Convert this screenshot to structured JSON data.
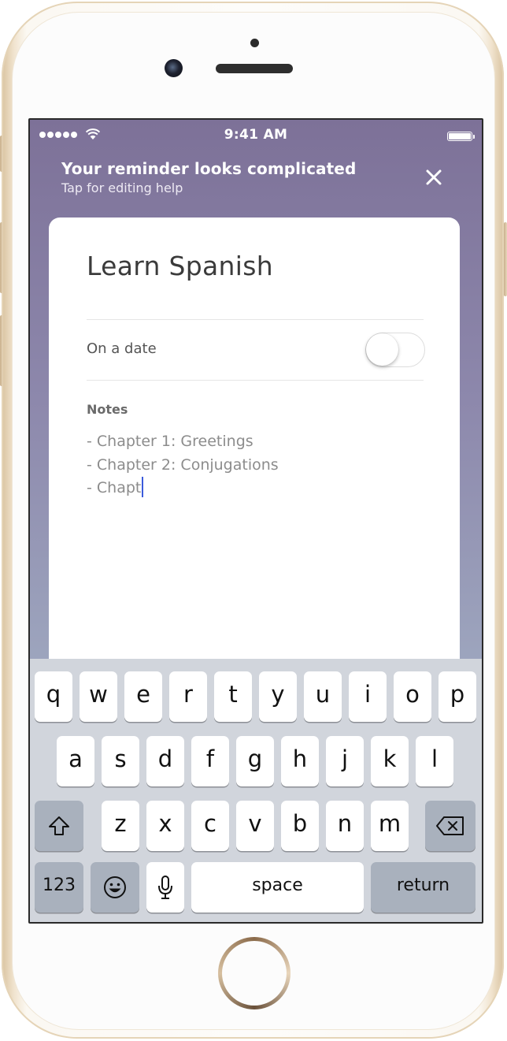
{
  "status_bar": {
    "time": "9:41 AM"
  },
  "banner": {
    "title": "Your reminder looks complicated",
    "subtitle": "Tap for editing help",
    "close_icon": "close-icon"
  },
  "reminder": {
    "title": "Learn Spanish",
    "date_toggle_label": "On a date",
    "date_toggle_on": false,
    "notes_label": "Notes",
    "notes_lines": [
      "- Chapter 1: Greetings",
      "- Chapter 2: Conjugations",
      "- Chapt"
    ]
  },
  "keyboard": {
    "row1": [
      "q",
      "w",
      "e",
      "r",
      "t",
      "y",
      "u",
      "i",
      "o",
      "p"
    ],
    "row2": [
      "a",
      "s",
      "d",
      "f",
      "g",
      "h",
      "j",
      "k",
      "l"
    ],
    "row3": [
      "z",
      "x",
      "c",
      "v",
      "b",
      "n",
      "m"
    ],
    "shift_icon": "shift-icon",
    "delete_icon": "backspace-icon",
    "numbers_label": "123",
    "emoji_icon": "emoji-icon",
    "mic_icon": "microphone-icon",
    "space_label": "space",
    "return_label": "return"
  },
  "colors": {
    "banner_gradient_top": "#7d7198",
    "banner_gradient_bottom": "#a6b3c6",
    "cursor": "#3b5bdb",
    "keyboard_bg": "#d1d5dc"
  }
}
